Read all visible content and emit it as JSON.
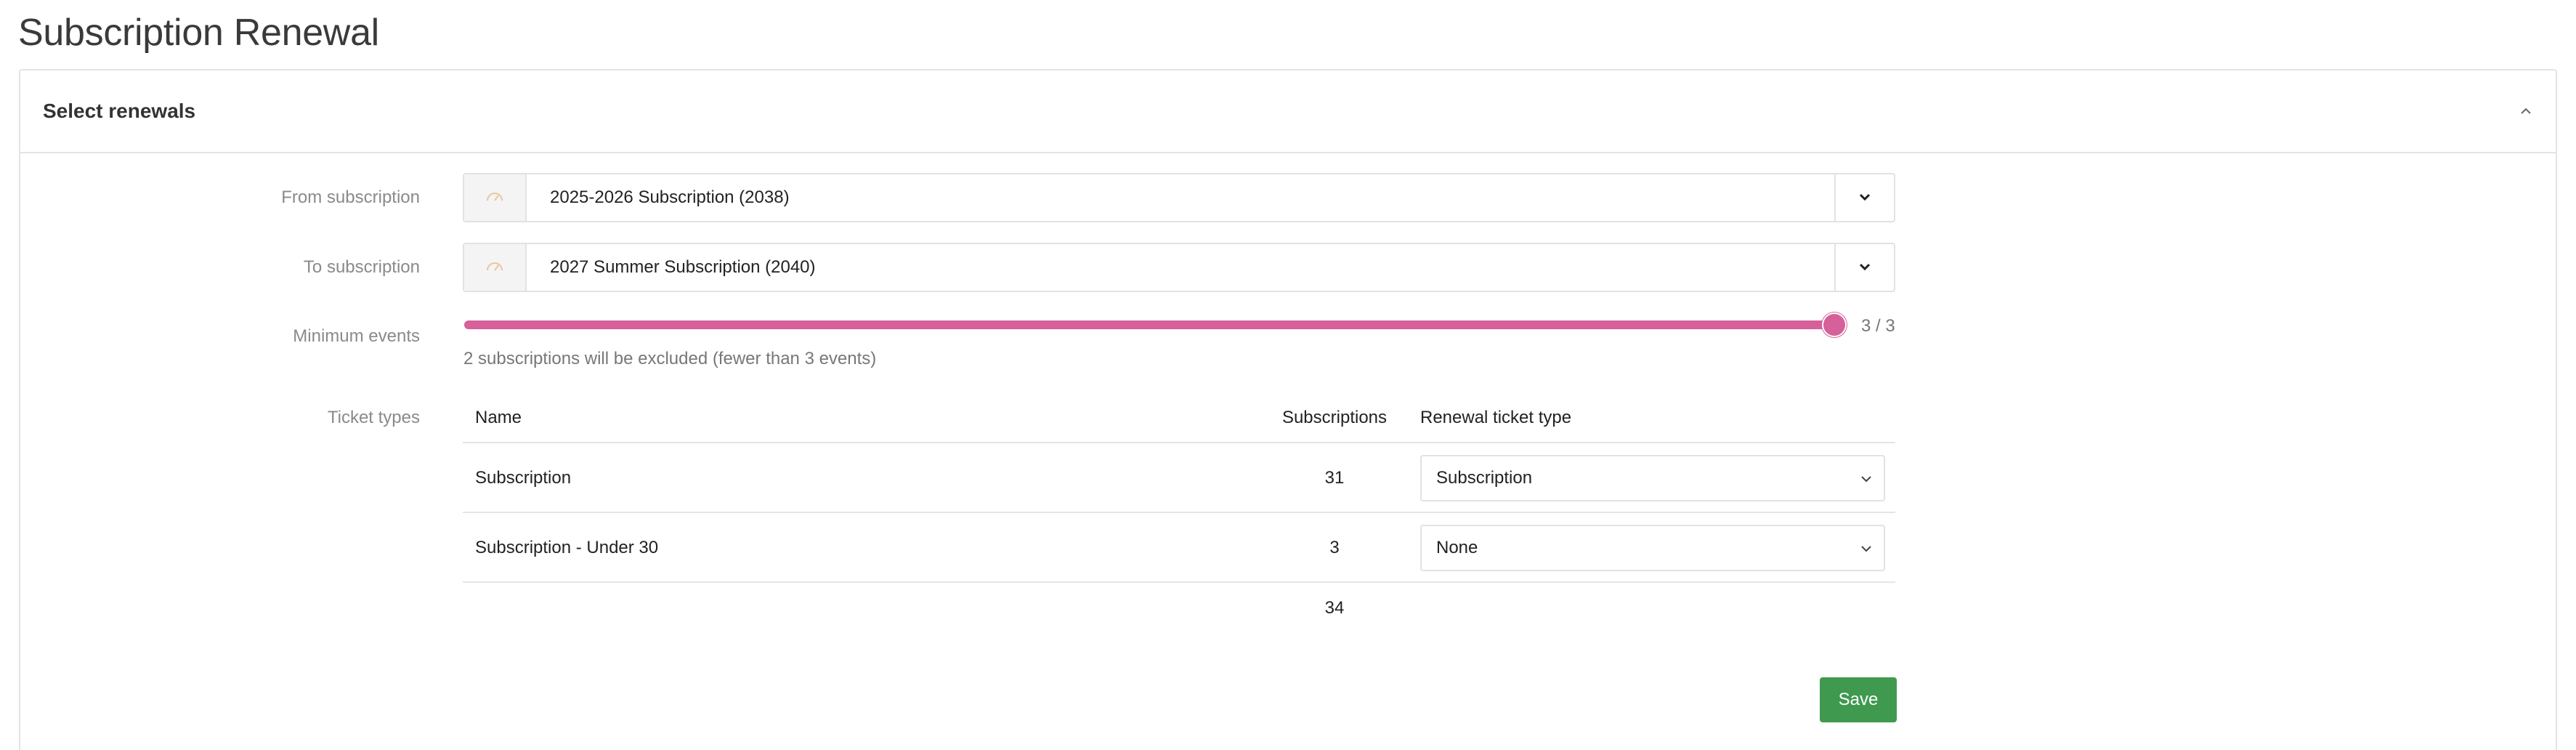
{
  "page": {
    "title": "Subscription Renewal"
  },
  "panel": {
    "title": "Select renewals",
    "collapse_icon": "chevron-up-icon"
  },
  "form": {
    "from": {
      "label": "From subscription",
      "value": "2025-2026 Subscription (2038)",
      "icon": "gauge-icon"
    },
    "to": {
      "label": "To subscription",
      "value": "2027 Summer Subscription (2040)",
      "icon": "gauge-icon"
    },
    "min_events": {
      "label": "Minimum events",
      "value": 3,
      "max": 3,
      "value_text": "3 / 3",
      "help": "2 subscriptions will be excluded (fewer than 3 events)"
    },
    "ticket_types": {
      "label": "Ticket types",
      "columns": [
        "Name",
        "Subscriptions",
        "Renewal ticket type"
      ],
      "rows": [
        {
          "name": "Subscription",
          "subscriptions": "31",
          "renewal": "Subscription"
        },
        {
          "name": "Subscription - Under 30",
          "subscriptions": "3",
          "renewal": "None"
        }
      ],
      "total": "34"
    }
  },
  "actions": {
    "save_label": "Save"
  },
  "colors": {
    "slider": "#d6609a",
    "save": "#3f9a4f",
    "addon_icon": "#e9c79a"
  }
}
